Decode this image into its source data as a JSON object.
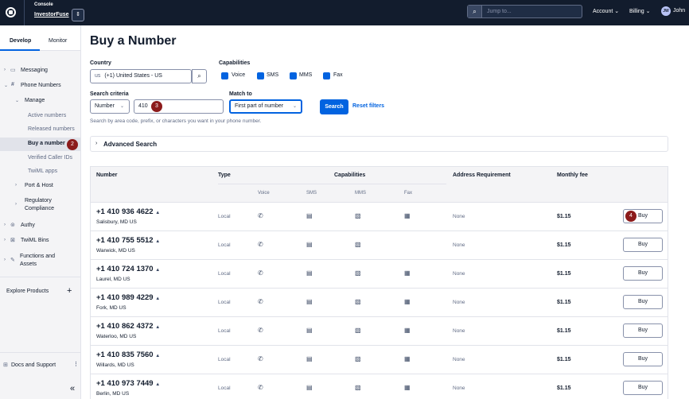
{
  "topbar": {
    "console_label": "Console",
    "account_name": "InvestorFuse",
    "search_placeholder": "Jump to...",
    "account_menu": "Account",
    "billing_menu": "Billing",
    "user_initials": "JW",
    "user_name": "John"
  },
  "sidebar": {
    "tabs": [
      "Develop",
      "Monitor"
    ],
    "items": {
      "messaging": "Messaging",
      "phone_numbers": "Phone Numbers",
      "manage": "Manage",
      "active_numbers": "Active numbers",
      "released_numbers": "Released numbers",
      "buy_a_number": "Buy a number",
      "verified_caller_ids": "Verified Caller IDs",
      "twiml_apps": "TwiML apps",
      "port_host": "Port & Host",
      "regulatory_1": "Regulatory",
      "regulatory_2": "Compliance",
      "authy": "Authy",
      "twiml_bins": "TwiML Bins",
      "functions_1": "Functions and",
      "functions_2": "Assets",
      "explore_products": "Explore Products",
      "docs_support": "Docs and Support"
    }
  },
  "callouts": {
    "two": "2",
    "three": "3",
    "four": "4"
  },
  "main": {
    "title": "Buy a Number",
    "country_label": "Country",
    "country_code": "us",
    "country_value": "(+1) United States - US",
    "capabilities_label": "Capabilities",
    "capabilities": [
      "Voice",
      "SMS",
      "MMS",
      "Fax"
    ],
    "search_criteria_label": "Search criteria",
    "criteria_type": "Number",
    "criteria_value": "410",
    "match_to_label": "Match to",
    "match_to_value": "First part of number",
    "search_button": "Search",
    "reset_link": "Reset filters",
    "help_text": "Search by area code, prefix, or characters you want in your phone number.",
    "advanced_search": "Advanced Search"
  },
  "table": {
    "headers": {
      "number": "Number",
      "type": "Type",
      "capabilities": "Capabilities",
      "address": "Address Requirement",
      "fee": "Monthly fee"
    },
    "cap_subheaders": [
      "Voice",
      "SMS",
      "MMS",
      "Fax"
    ],
    "buy_label": "Buy",
    "rows": [
      {
        "number": "+1 410 936 4622",
        "location": "Salisbury, MD US",
        "type": "Local",
        "address": "None",
        "fee": "$1.15"
      },
      {
        "number": "+1 410 755 5512",
        "location": "Warwick, MD US",
        "type": "Local",
        "address": "None",
        "fee": "$1.15"
      },
      {
        "number": "+1 410 724 1370",
        "location": "Laurel, MD US",
        "type": "Local",
        "address": "None",
        "fee": "$1.15"
      },
      {
        "number": "+1 410 989 4229",
        "location": "Fork, MD US",
        "type": "Local",
        "address": "None",
        "fee": "$1.15"
      },
      {
        "number": "+1 410 862 4372",
        "location": "Waterloo, MD US",
        "type": "Local",
        "address": "None",
        "fee": "$1.15"
      },
      {
        "number": "+1 410 835 7560",
        "location": "Willards, MD US",
        "type": "Local",
        "address": "None",
        "fee": "$1.15"
      },
      {
        "number": "+1 410 973 7449",
        "location": "Berlin, MD US",
        "type": "Local",
        "address": "None",
        "fee": "$1.15"
      }
    ]
  },
  "colors": {
    "topbar": "#121c2d",
    "primary": "#0263e0",
    "callout": "#8c1b1b",
    "sidebar": "#f4f4f6"
  }
}
